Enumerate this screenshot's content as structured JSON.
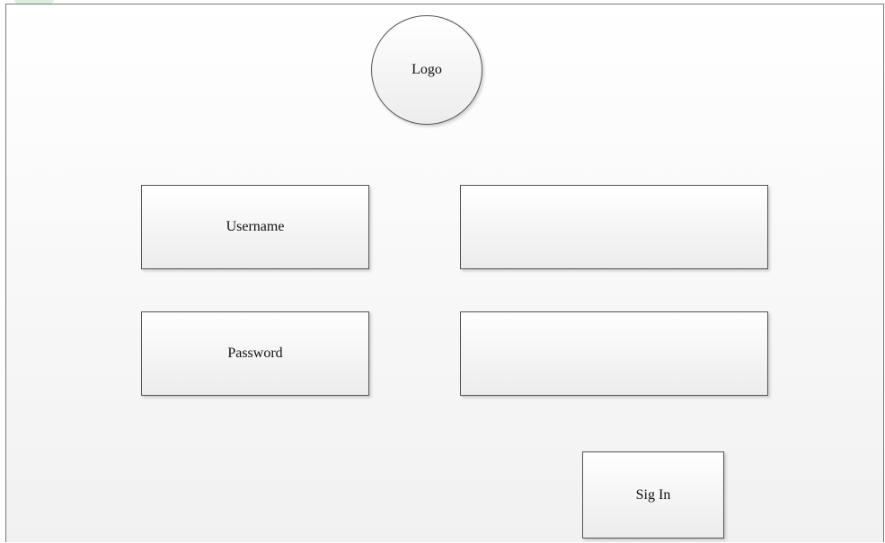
{
  "logo": {
    "label": "Logo"
  },
  "form": {
    "username_label": "Username",
    "username_value": "",
    "password_label": "Password",
    "password_value": "",
    "signin_label": "Sig In"
  }
}
